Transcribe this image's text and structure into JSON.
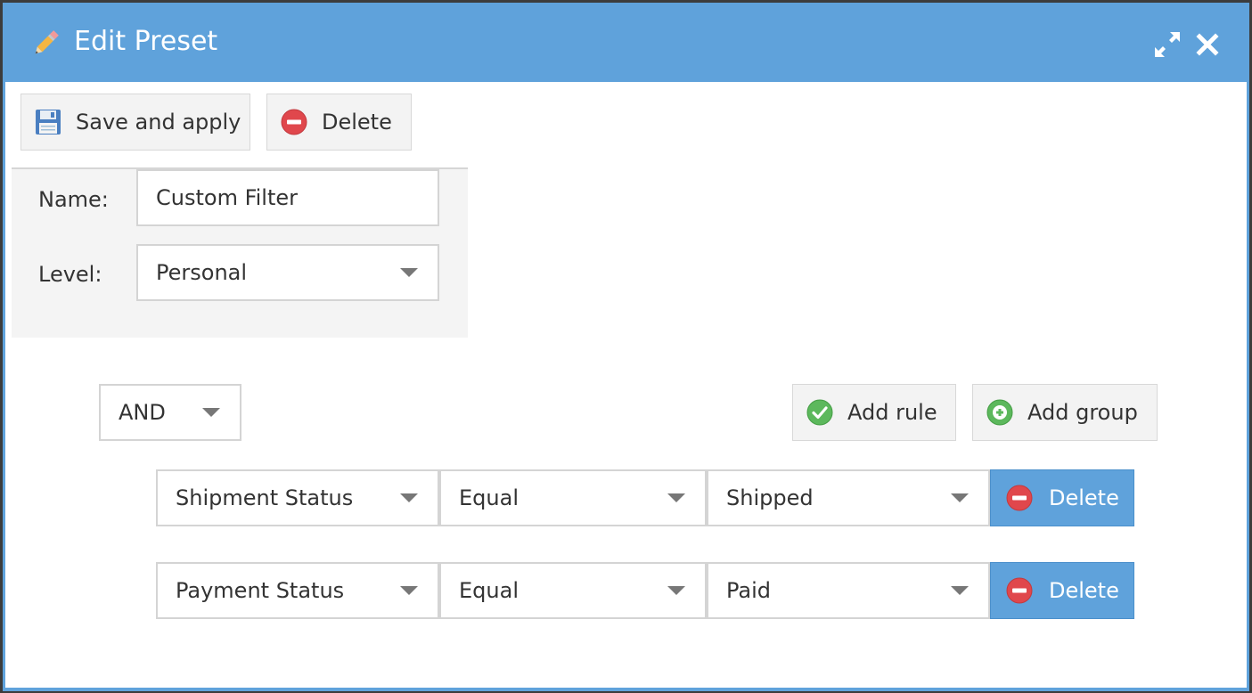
{
  "dialog": {
    "title": "Edit Preset",
    "title_icon": "pencil-icon",
    "maximize_icon": "expand-icon",
    "close_icon": "close-icon"
  },
  "toolbar": {
    "save_label": "Save and apply",
    "save_icon": "floppy-disk-icon",
    "delete_label": "Delete",
    "delete_icon": "minus-circle-icon"
  },
  "form": {
    "name_label": "Name:",
    "name_value": "Custom Filter",
    "level_label": "Level:",
    "level_value": "Personal"
  },
  "query_builder": {
    "condition": "AND",
    "add_rule_label": "Add rule",
    "add_rule_icon": "check-circle-icon",
    "add_group_label": "Add group",
    "add_group_icon": "plus-circle-icon",
    "rules": [
      {
        "field": "Shipment Status",
        "operator": "Equal",
        "value": "Shipped",
        "delete_label": "Delete"
      },
      {
        "field": "Payment Status",
        "operator": "Equal",
        "value": "Paid",
        "delete_label": "Delete"
      }
    ]
  },
  "colors": {
    "accent": "#5fa2db",
    "delete_red": "#e0474c",
    "add_green": "#5cb85c"
  }
}
